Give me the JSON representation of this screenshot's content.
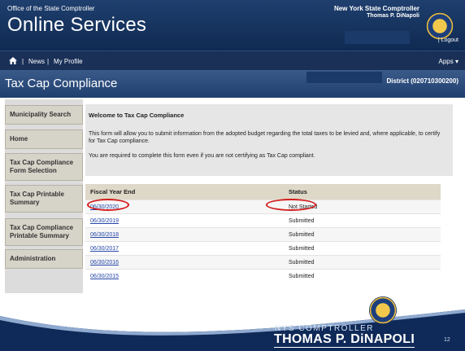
{
  "header": {
    "office": "Office of the State Comptroller",
    "app_title": "Online Services",
    "comptroller_title": "New York State Comptroller",
    "comptroller_name": "Thomas P. DiNapoli",
    "logout": "| Logout"
  },
  "nav": {
    "news": "News",
    "my_profile": "My Profile",
    "separator": "|",
    "apps": "Apps ▾"
  },
  "page": {
    "title": "Tax Cap Compliance",
    "district": "District (020710300200)"
  },
  "sidebar": {
    "items": [
      {
        "label": "Municipality Search"
      },
      {
        "label": "Home"
      },
      {
        "label": "Tax Cap Compliance Form Selection"
      },
      {
        "label": "Tax Cap Printable Summary"
      },
      {
        "label": "Tax Cap Compliance Printable Summary"
      },
      {
        "label": "Administration"
      }
    ]
  },
  "welcome": {
    "heading": "Welcome to Tax Cap Compliance",
    "para1": "This form will allow you to submit information from the adopted budget regarding the total taxes to be levied and, where applicable, to certify for Tax Cap compliance.",
    "para2": "You are required to complete this form even if you are not certifying as Tax Cap compliant."
  },
  "table": {
    "headers": [
      "Fiscal Year End",
      "Status"
    ],
    "rows": [
      {
        "fiscal_year_end": "06/30/2020",
        "status": "Not Started"
      },
      {
        "fiscal_year_end": "06/30/2019",
        "status": "Submitted"
      },
      {
        "fiscal_year_end": "06/30/2018",
        "status": "Submitted"
      },
      {
        "fiscal_year_end": "06/30/2017",
        "status": "Submitted"
      },
      {
        "fiscal_year_end": "06/30/2016",
        "status": "Submitted"
      },
      {
        "fiscal_year_end": "06/30/2015",
        "status": "Submitted"
      }
    ]
  },
  "footer": {
    "line1": "NYS COMPTROLLER",
    "line2": "THOMAS P. DiNAPOLI",
    "slide_number": "12"
  },
  "icons": {
    "home": "home-icon",
    "seal": "seal-icon"
  },
  "colors": {
    "header_navy": "#1f3f6e",
    "nav_navy": "#1a3057",
    "link_blue": "#2446a8",
    "highlight_red": "#d31d1d",
    "sidebar_tan": "#d6d3c8"
  }
}
